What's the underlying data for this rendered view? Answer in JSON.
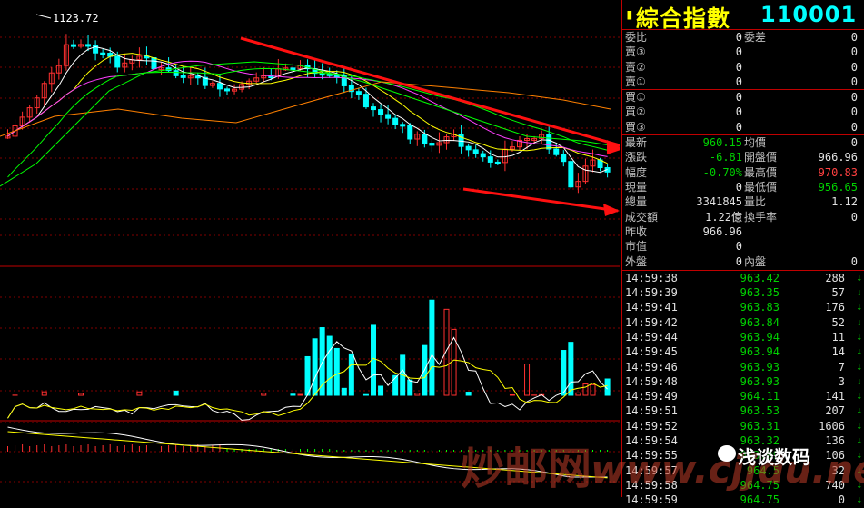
{
  "header": {
    "name": "綜合指數",
    "code": "110001",
    "icon": "black-triangle-icon"
  },
  "chart": {
    "high_label": "1123.72"
  },
  "quote_order": [
    {
      "label": "委比",
      "value": "0",
      "label2": "委差",
      "value2": "0"
    },
    {
      "label": "賣③",
      "value": "0",
      "label2": "",
      "value2": "0"
    },
    {
      "label": "賣②",
      "value": "0",
      "label2": "",
      "value2": "0"
    },
    {
      "label": "賣①",
      "value": "0",
      "label2": "",
      "value2": "0"
    }
  ],
  "quote_buy": [
    {
      "label": "買①",
      "value": "0",
      "value2": "0"
    },
    {
      "label": "買②",
      "value": "0",
      "value2": "0"
    },
    {
      "label": "買③",
      "value": "0",
      "value2": "0"
    }
  ],
  "quote_stats": [
    {
      "label": "最新",
      "value": "960.15",
      "vc": "g",
      "label2": "均價",
      "value2": "0",
      "v2c": "w"
    },
    {
      "label": "漲跌",
      "value": "-6.81",
      "vc": "g",
      "label2": "開盤價",
      "value2": "966.96",
      "v2c": "w"
    },
    {
      "label": "幅度",
      "value": "-0.70%",
      "vc": "g",
      "label2": "最高價",
      "value2": "970.83",
      "v2c": "r"
    },
    {
      "label": "現量",
      "value": "0",
      "vc": "w",
      "label2": "最低價",
      "value2": "956.65",
      "v2c": "g"
    },
    {
      "label": "總量",
      "value": "3341845",
      "vc": "w",
      "label2": "量比",
      "value2": "1.12",
      "v2c": "w"
    },
    {
      "label": "成交額",
      "value": "1.22億",
      "vc": "w",
      "label2": "換手率",
      "value2": "0",
      "v2c": "w"
    },
    {
      "label": "昨收",
      "value": "966.96",
      "vc": "w",
      "label2": "",
      "value2": "",
      "v2c": "w"
    },
    {
      "label": "市值",
      "value": "0",
      "vc": "w",
      "label2": "",
      "value2": "",
      "v2c": "w"
    }
  ],
  "outer_inner": {
    "label": "外盤",
    "value": "0",
    "label2": "內盤",
    "value2": "0"
  },
  "ticks": [
    {
      "time": "14:59:38",
      "price": "963.42",
      "vol": "288"
    },
    {
      "time": "14:59:39",
      "price": "963.35",
      "vol": "57"
    },
    {
      "time": "14:59:41",
      "price": "963.83",
      "vol": "176"
    },
    {
      "time": "14:59:42",
      "price": "963.84",
      "vol": "52"
    },
    {
      "time": "14:59:44",
      "price": "963.94",
      "vol": "11"
    },
    {
      "time": "14:59:45",
      "price": "963.94",
      "vol": "14"
    },
    {
      "time": "14:59:46",
      "price": "963.93",
      "vol": "7"
    },
    {
      "time": "14:59:48",
      "price": "963.93",
      "vol": "3"
    },
    {
      "time": "14:59:49",
      "price": "964.11",
      "vol": "141"
    },
    {
      "time": "14:59:51",
      "price": "963.53",
      "vol": "207"
    },
    {
      "time": "14:59:52",
      "price": "963.31",
      "vol": "1606"
    },
    {
      "time": "14:59:54",
      "price": "963.32",
      "vol": "136"
    },
    {
      "time": "14:59:55",
      "price": "963.99",
      "vol": "106"
    },
    {
      "time": "14:59:57",
      "price": "964.5",
      "vol": "32"
    },
    {
      "time": "14:59:58",
      "price": "964.75",
      "vol": "740"
    },
    {
      "time": "14:59:59",
      "price": "964.75",
      "vol": "0"
    }
  ],
  "tick_arrow": "↓",
  "watermark": {
    "left": "炒邮网",
    "mid": "www.cjjdu.net",
    "brand": "浅谈数码"
  },
  "colors": {
    "up": "#ff3030",
    "down": "#00ffff",
    "ma5": "#ffffff",
    "ma10": "#ffff00",
    "ma20": "#ff40ff",
    "ma30": "#00ff00",
    "ma60": "#ff8000",
    "trend": "#ff1010"
  }
}
